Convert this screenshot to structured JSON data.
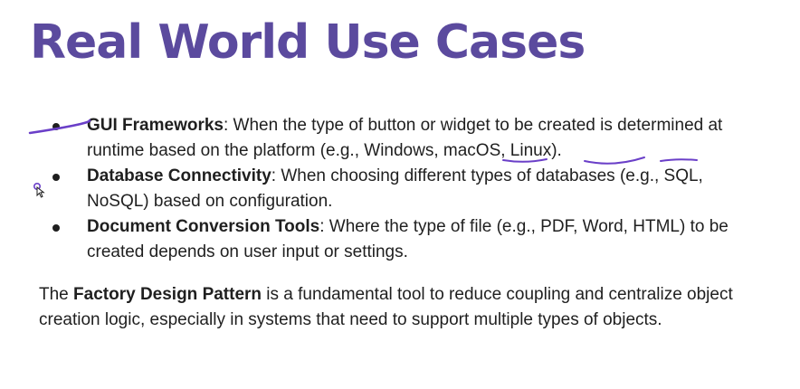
{
  "slide": {
    "title": "Real World Use Cases"
  },
  "bullets": [
    {
      "term": "GUI Frameworks",
      "text": ": When the type of button or widget to be created is determined at runtime based on the platform (e.g., Windows, macOS, Linux)."
    },
    {
      "term": "Database Connectivity",
      "text": ": When choosing different types of databases (e.g., SQL, NoSQL) based on configuration."
    },
    {
      "term": "Document Conversion Tools",
      "text": ": Where the type of file (e.g., PDF, Word, HTML) to be created depends on user input or settings."
    }
  ],
  "paragraph": {
    "lead": "The ",
    "term": "Factory Design Pattern",
    "rest": " is a fundamental tool to reduce coupling and centralize object creation logic, especially in systems that need to support multiple types of objects."
  },
  "colors": {
    "title": "#5b4a9e",
    "ink_annotation": "#6a3fc8",
    "text": "#1f1f1f"
  }
}
